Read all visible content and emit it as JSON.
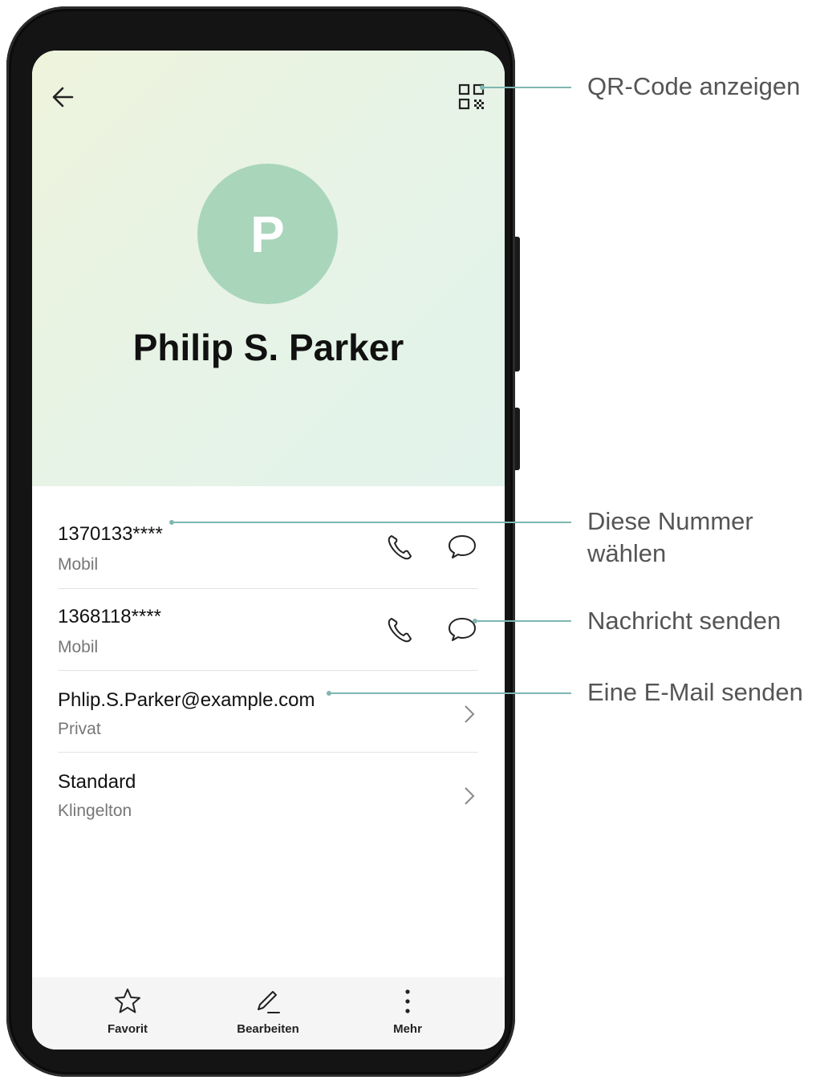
{
  "contact": {
    "initial": "P",
    "name": "Philip S. Parker"
  },
  "details": [
    {
      "primary": "1370133****",
      "secondary": "Mobil"
    },
    {
      "primary": "1368118****",
      "secondary": "Mobil"
    },
    {
      "primary": "Phlip.S.Parker@example.com",
      "secondary": "Privat"
    },
    {
      "primary": "Standard",
      "secondary": "Klingelton"
    }
  ],
  "bottom_bar": {
    "favorite": "Favorit",
    "edit": "Bearbeiten",
    "more": "Mehr"
  },
  "callouts": {
    "qr": "QR-Code anzeigen",
    "dial_line1": "Diese Nummer",
    "dial_line2": "wählen",
    "message": "Nachricht senden",
    "email": "Eine E-Mail senden"
  },
  "icons": {
    "back": "arrow-left-icon",
    "qr": "qr-code-icon",
    "call": "phone-icon",
    "message": "chat-bubble-icon",
    "chevron": "chevron-right-icon",
    "favorite": "star-icon",
    "edit": "pencil-icon",
    "more": "more-vertical-icon"
  },
  "colors": {
    "avatar": "#a9d5bb",
    "leader": "#7fb6b1",
    "header_gradient_start": "#eef3dc",
    "header_gradient_end": "#e2f3ec"
  }
}
